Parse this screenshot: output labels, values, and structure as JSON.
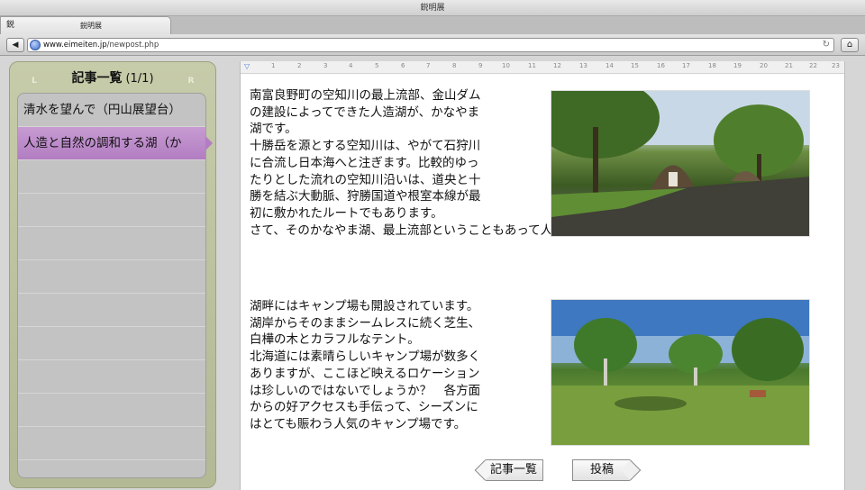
{
  "window": {
    "title": "鋭明展"
  },
  "tab": {
    "icon_text": "鋭",
    "title": "鋭明展"
  },
  "address_bar": {
    "url_host": "www.eimeiten.jp",
    "url_path": "/newpost.php",
    "back_icon": "left-triangle-icon",
    "reload_icon": "reload-icon",
    "home_icon": "home-icon"
  },
  "sidebar": {
    "title": "記事一覧",
    "page_count": "(1/1)",
    "nav_prev": "L",
    "nav_next": "R",
    "items": [
      {
        "label": "清水を望んで（円山展望台）"
      },
      {
        "label": "人造と自然の調和する湖（か"
      },
      {
        "label": ""
      },
      {
        "label": ""
      },
      {
        "label": ""
      },
      {
        "label": ""
      },
      {
        "label": ""
      },
      {
        "label": ""
      },
      {
        "label": ""
      },
      {
        "label": ""
      },
      {
        "label": ""
      }
    ],
    "selected_index": 1,
    "selected_color": "#b27dc2"
  },
  "ruler": {
    "ticks": [
      "1",
      "2",
      "3",
      "4",
      "5",
      "6",
      "7",
      "8",
      "9",
      "10",
      "11",
      "12",
      "13",
      "14",
      "15",
      "16",
      "17",
      "18",
      "19",
      "20",
      "21",
      "22",
      "23"
    ]
  },
  "article": {
    "block1": {
      "lines": [
        "南富良野町の空知川の最上流部、金山ダム",
        "の建設によってできた人造湖が、かなやま",
        "湖です。",
        "十勝岳を源とする空知川は、やがて石狩川",
        "に合流し日本海へと注ぎます。比較的ゆっ",
        "たりとした流れの空知川沿いは、道央と十",
        "勝を結ぶ大動脈、狩勝国道や根室本線が最",
        "初に敷かれたルートでもあります。",
        "さて、そのかなやま湖、最上流部ということもあって人造湖とは思えない美しさです。"
      ]
    },
    "block2": {
      "lines": [
        "湖畔にはキャンプ場も開設されています。",
        "湖岸からそのままシームレスに続く芝生、",
        "白樺の木とカラフルなテント。",
        "北海道には素晴らしいキャンプ場が数多く",
        "ありますが、ここほど映えるロケーション",
        "は珍しいのではないでしょうか？　各方面",
        "からの好アクセスも手伝って、シーズンに",
        "はとても賑わう人気のキャンプ場です。"
      ]
    }
  },
  "buttons": {
    "prev_label": "記事一覧",
    "post_label": "投稿"
  }
}
